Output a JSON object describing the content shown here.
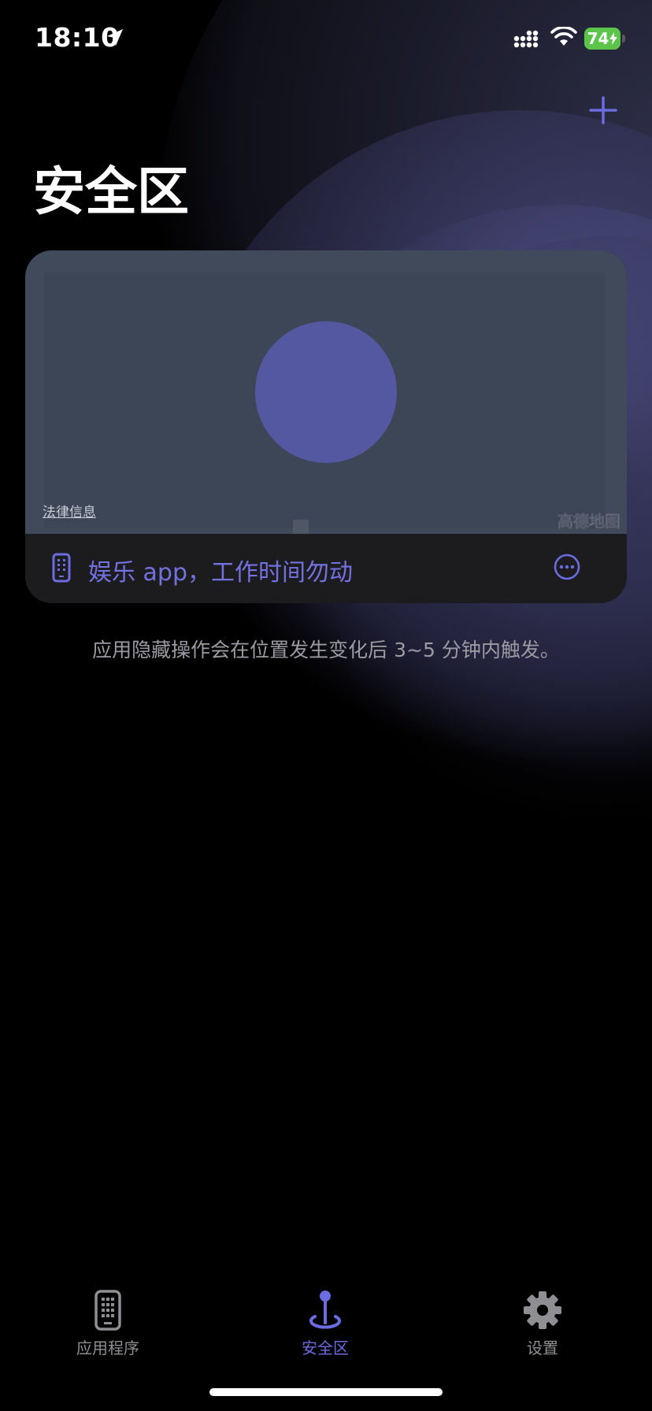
{
  "status_bar": {
    "time": "18:10",
    "battery": "74"
  },
  "header": {
    "title": "安全区"
  },
  "zone_card": {
    "legal_link": "法律信息",
    "map_logo": "高德地图",
    "name": "娱乐 app，工作时间勿动"
  },
  "description": "应用隐藏操作会在位置发生变化后 3~5 分钟内触发。",
  "tab_bar": {
    "items": [
      {
        "label": "应用程序",
        "icon": "phone-grid-icon"
      },
      {
        "label": "安全区",
        "icon": "location-pin-icon"
      },
      {
        "label": "设置",
        "icon": "gear-icon"
      }
    ],
    "selected": "安全区"
  },
  "colors": {
    "accent": "#6b6ce0",
    "card": "#1c1c1e",
    "map": "#414a5a",
    "zone": "#5458a0",
    "battery": "#5cc44a"
  }
}
